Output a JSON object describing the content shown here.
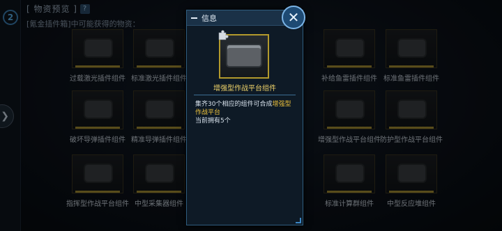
{
  "header": {
    "title": "[ 物资预览 ]",
    "help": "?",
    "subtitle": "[氪金插件箱]中可能获得的物资："
  },
  "logo": "2",
  "grid_items": [
    {
      "label": "过载激光插件组件"
    },
    {
      "label": "标准激光插件组件"
    },
    {
      "label": "补给鱼雷插件组件"
    },
    {
      "label": "标准鱼雷插件组件"
    },
    {
      "label": "破坏导弹插件组件"
    },
    {
      "label": "精准导弹插件组件"
    },
    {
      "label": "增强型作战平台组件"
    },
    {
      "label": "防护型作战平台组件"
    },
    {
      "label": "指挥型作战平台组件"
    },
    {
      "label": "中型采集器组件"
    },
    {
      "label": "标准计算群组件"
    },
    {
      "label": "中型反应堆组件"
    }
  ],
  "modal": {
    "title": "信息",
    "item_name": "增强型作战平台组件",
    "desc_prefix": "集齐30个相应的组件可合成",
    "desc_highlight": "增强型作战平台",
    "owned": "当前拥有5个"
  },
  "icons": {
    "close": "close-icon",
    "collapse": "minus-icon",
    "nav": "chevron-right-icon",
    "puzzle": "puzzle-icon"
  },
  "colors": {
    "accent": "#7bb4e6",
    "highlight": "#f0c43c",
    "item_name": "#f0d46a",
    "frame_gold": "#b39a2c"
  }
}
